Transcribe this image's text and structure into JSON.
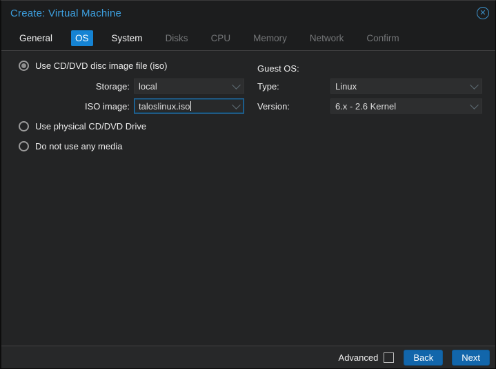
{
  "window": {
    "title": "Create: Virtual Machine",
    "close_icon": "circle-x"
  },
  "tabs": [
    {
      "label": "General",
      "state": "enabled"
    },
    {
      "label": "OS",
      "state": "active"
    },
    {
      "label": "System",
      "state": "enabled"
    },
    {
      "label": "Disks",
      "state": "disabled"
    },
    {
      "label": "CPU",
      "state": "disabled"
    },
    {
      "label": "Memory",
      "state": "disabled"
    },
    {
      "label": "Network",
      "state": "disabled"
    },
    {
      "label": "Confirm",
      "state": "disabled"
    }
  ],
  "form": {
    "left": {
      "radio_iso": {
        "label": "Use CD/DVD disc image file (iso)",
        "selected": true
      },
      "storage": {
        "label": "Storage:",
        "value": "local"
      },
      "iso_image": {
        "label": "ISO image:",
        "value": "taloslinux.iso",
        "focused": true
      },
      "radio_physical": {
        "label": "Use physical CD/DVD Drive",
        "selected": false
      },
      "radio_none": {
        "label": "Do not use any media",
        "selected": false
      }
    },
    "right": {
      "guest_os_label": "Guest OS:",
      "type": {
        "label": "Type:",
        "value": "Linux"
      },
      "version": {
        "label": "Version:",
        "value": "6.x - 2.6 Kernel"
      }
    }
  },
  "footer": {
    "advanced_label": "Advanced",
    "advanced_checked": false,
    "back_label": "Back",
    "next_label": "Next"
  },
  "colors": {
    "accent_tab": "#1583d3",
    "button_blue": "#1266ab",
    "title_blue": "#3da0e0",
    "focus_border": "#2179bb",
    "background": "#222324",
    "field_background": "#2d2e2f",
    "disabled_text": "#747678"
  }
}
